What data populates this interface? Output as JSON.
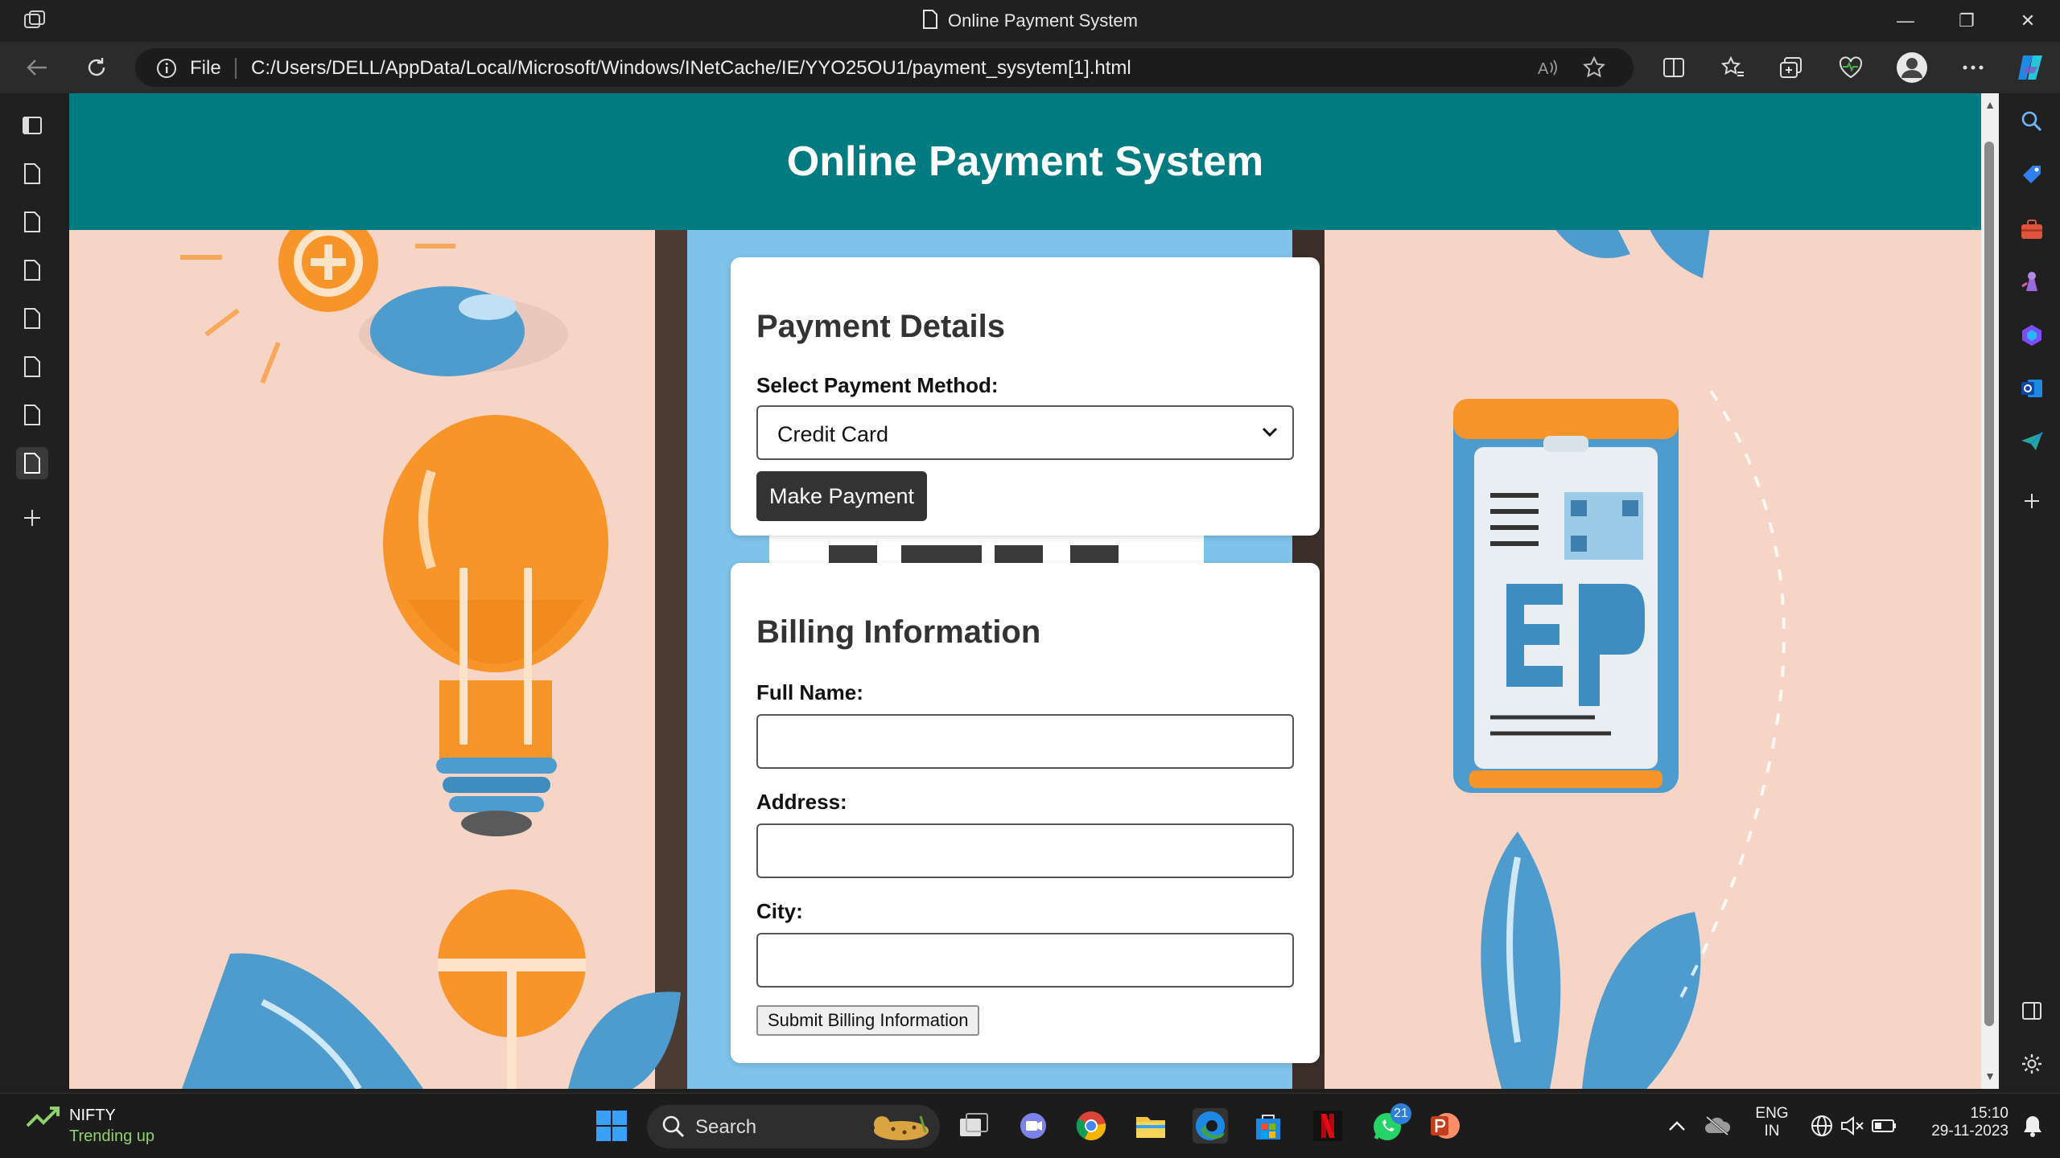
{
  "window": {
    "title": "Online Payment System",
    "minimize": "—",
    "restore": "❐",
    "close": "✕"
  },
  "address_bar": {
    "scheme_label": "File",
    "url": "C:/Users/DELL/AppData/Local/Microsoft/Windows/INetCache/IE/YYO25OU1/payment_sysytem[1].html"
  },
  "page": {
    "header_title": "Online Payment System",
    "payment": {
      "heading": "Payment Details",
      "method_label": "Select Payment Method:",
      "method_selected": "Credit Card",
      "pay_button": "Make Payment"
    },
    "billing": {
      "heading": "Billing Information",
      "full_name_label": "Full Name:",
      "full_name_value": "",
      "address_label": "Address:",
      "address_value": "",
      "city_label": "City:",
      "city_value": "",
      "submit_button": "Submit Billing Information"
    }
  },
  "taskbar": {
    "widget_title": "NIFTY",
    "widget_subtitle": "Trending up",
    "search_label": "Search",
    "whatsapp_badge": "21",
    "lang_line1": "ENG",
    "lang_line2": "IN",
    "time": "15:10",
    "date": "29-11-2023"
  },
  "colors": {
    "header_teal": "#007b7f",
    "page_background": "#f7d5c6",
    "pay_button": "#333333",
    "accent_blue": "#5aa7d6",
    "accent_orange": "#f7942a"
  }
}
